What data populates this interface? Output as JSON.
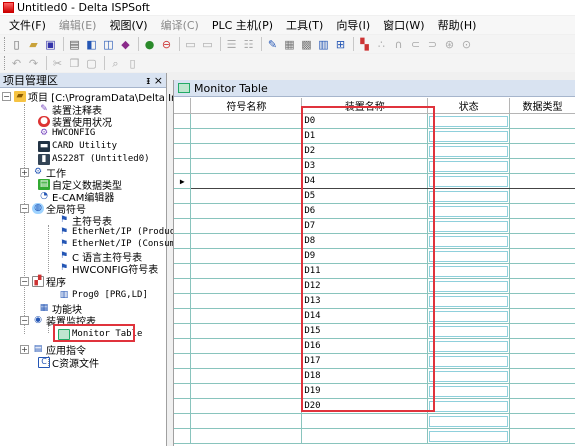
{
  "window": {
    "title": "Untitled0 - Delta ISPSoft"
  },
  "menu": [
    {
      "label": "文件(F)",
      "disabled": false
    },
    {
      "label": "编辑(E)",
      "disabled": true
    },
    {
      "label": "视图(V)",
      "disabled": false
    },
    {
      "label": "编译(C)",
      "disabled": true
    },
    {
      "label": "PLC 主机(P)",
      "disabled": false
    },
    {
      "label": "工具(T)",
      "disabled": false
    },
    {
      "label": "向导(I)",
      "disabled": false
    },
    {
      "label": "窗口(W)",
      "disabled": false
    },
    {
      "label": "帮助(H)",
      "disabled": false
    }
  ],
  "project_panel": {
    "title": "项目管理区",
    "pin": "ᵻ ×"
  },
  "tree": {
    "root": "项目 [C:\\ProgramData\\Delta In",
    "annotation": "装置注释表",
    "device_usage": "装置使用状况",
    "hwconfig": "HWCONFIG",
    "card_utility": "CARD Utility",
    "plc_model": "AS228T  (Untitled0)",
    "work": "工作",
    "custom_types": "自定义数据类型",
    "ecam": "E-CAM编辑器",
    "global_symbols": "全局符号",
    "main_symbols": "主符号表",
    "eip_produce": "EtherNet/IP (Produce",
    "eip_consume": "EtherNet/IP (Consume",
    "c_symbols": "C 语言主符号表",
    "hw_symbols": "HWCONFIG符号表",
    "program": "程序",
    "prog0": "Prog0 [PRG,LD]",
    "function_blocks": "功能块",
    "device_monitor": "装置监控表",
    "monitor_table": "Monitor Table",
    "app_instructions": "应用指令",
    "c_resources": "C资源文件"
  },
  "monitor": {
    "title": "Monitor Table",
    "columns": [
      "符号名称",
      "装置名称",
      "状态",
      "数据类型"
    ],
    "current_row_marker": "▶",
    "current_row": 4,
    "rows": [
      {
        "device": "D0"
      },
      {
        "device": "D1"
      },
      {
        "device": "D2"
      },
      {
        "device": "D3"
      },
      {
        "device": "D4"
      },
      {
        "device": "D5"
      },
      {
        "device": "D6"
      },
      {
        "device": "D7"
      },
      {
        "device": "D8"
      },
      {
        "device": "D9"
      },
      {
        "device": "D11"
      },
      {
        "device": "D12"
      },
      {
        "device": "D13"
      },
      {
        "device": "D14"
      },
      {
        "device": "D15"
      },
      {
        "device": "D16"
      },
      {
        "device": "D17"
      },
      {
        "device": "D18"
      },
      {
        "device": "D19"
      },
      {
        "device": "D20"
      },
      {
        "device": ""
      },
      {
        "device": ""
      }
    ]
  },
  "colors": {
    "highlight_box": "#e0333c",
    "grid_line": "#89c4bd",
    "panel_header": "#d9e3f1"
  }
}
